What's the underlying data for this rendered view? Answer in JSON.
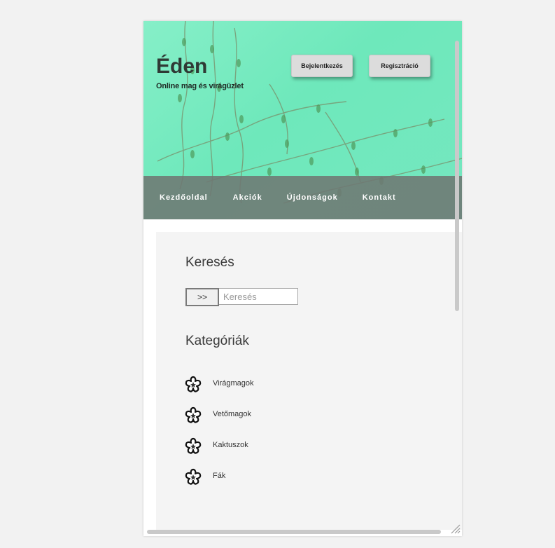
{
  "header": {
    "title": "Éden",
    "subtitle": "Online mag és virágüzlet",
    "login_label": "Bejelentkezés",
    "register_label": "Regisztráció"
  },
  "nav": {
    "items": [
      "Kezdőoldal",
      "Akciók",
      "Újdonságok",
      "Kontakt"
    ]
  },
  "search": {
    "title": "Keresés",
    "button_label": ">>",
    "placeholder": "Keresés"
  },
  "categories": {
    "title": "Kategóriák",
    "items": [
      {
        "label": "Virágmagok",
        "icon": "flower-icon"
      },
      {
        "label": "Vetőmagok",
        "icon": "flower-icon"
      },
      {
        "label": "Kaktuszok",
        "icon": "flower-icon"
      },
      {
        "label": "Fák",
        "icon": "flower-icon"
      }
    ]
  },
  "colors": {
    "header_green": "#7eecc4",
    "nav_bar": "#6e7873",
    "content_bg": "#f4f4f4"
  }
}
